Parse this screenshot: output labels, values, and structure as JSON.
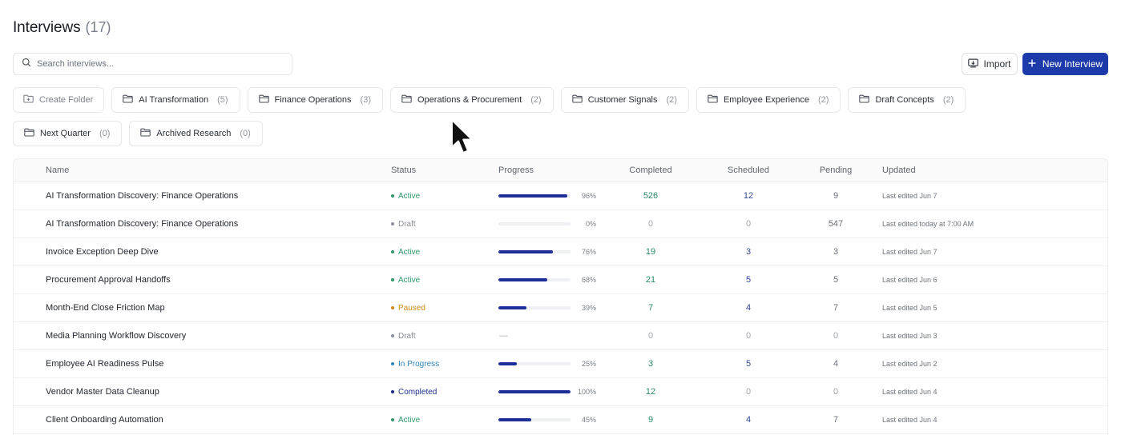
{
  "page": {
    "title": "Interviews",
    "count": "(17)"
  },
  "search": {
    "placeholder": "Search interviews...",
    "icon": "search-icon"
  },
  "actions": {
    "import_label": "Import",
    "import_icon": "import-icon",
    "new_label": "New Interview",
    "new_icon": "plus-icon"
  },
  "folders": {
    "create_label": "Create Folder",
    "items": [
      {
        "label": "AI Transformation",
        "count": "(5)"
      },
      {
        "label": "Finance Operations",
        "count": "(3)"
      },
      {
        "label": "Operations & Procurement",
        "count": "(2)"
      },
      {
        "label": "Customer Signals",
        "count": "(2)"
      },
      {
        "label": "Employee Experience",
        "count": "(2)"
      },
      {
        "label": "Draft Concepts",
        "count": "(2)"
      },
      {
        "label": "Next Quarter",
        "count": "(0)"
      },
      {
        "label": "Archived Research",
        "count": "(0)"
      }
    ]
  },
  "table": {
    "headers": {
      "name": "Name",
      "status": "Status",
      "progress": "Progress",
      "completed": "Completed",
      "scheduled": "Scheduled",
      "pending": "Pending",
      "updated": "Updated"
    },
    "rows": [
      {
        "name": "AI Transformation Discovery: Finance Operations",
        "status": "Active",
        "progress": 0.96,
        "progress_label": "96%",
        "completed": "526",
        "scheduled": "12",
        "pending": "9",
        "updated": "Last edited Jun 7"
      },
      {
        "name": "AI Transformation Discovery: Finance Operations",
        "status": "Draft",
        "progress": 0,
        "progress_label": "0%",
        "completed": "0",
        "scheduled": "0",
        "pending": "547",
        "updated": "Last edited today at 7:00 AM"
      },
      {
        "name": "Invoice Exception Deep Dive",
        "status": "Active",
        "progress": 0.76,
        "progress_label": "76%",
        "completed": "19",
        "scheduled": "3",
        "pending": "3",
        "updated": "Last edited Jun 7"
      },
      {
        "name": "Procurement Approval Handoffs",
        "status": "Active",
        "progress": 0.68,
        "progress_label": "68%",
        "completed": "21",
        "scheduled": "5",
        "pending": "5",
        "updated": "Last edited Jun 6"
      },
      {
        "name": "Month-End Close Friction Map",
        "status": "Paused",
        "progress": 0.39,
        "progress_label": "39%",
        "completed": "7",
        "scheduled": "4",
        "pending": "7",
        "updated": "Last edited Jun 5"
      },
      {
        "name": "Media Planning Workflow Discovery",
        "status": "Draft",
        "progress": null,
        "progress_label": "—",
        "completed": "0",
        "scheduled": "0",
        "pending": "0",
        "updated": "Last edited Jun 3"
      },
      {
        "name": "Employee AI Readiness Pulse",
        "status": "In Progress",
        "progress": 0.25,
        "progress_label": "25%",
        "completed": "3",
        "scheduled": "5",
        "pending": "4",
        "updated": "Last edited Jun 2"
      },
      {
        "name": "Vendor Master Data Cleanup",
        "status": "Completed",
        "progress": 1.0,
        "progress_label": "100%",
        "completed": "12",
        "scheduled": "0",
        "pending": "0",
        "updated": "Last edited Jun 4"
      },
      {
        "name": "Client Onboarding Automation",
        "status": "Active",
        "progress": 0.45,
        "progress_label": "45%",
        "completed": "9",
        "scheduled": "4",
        "pending": "7",
        "updated": "Last edited Jun 4"
      }
    ]
  },
  "colors": {
    "accent": "#1c3aa9",
    "progress_fill": "#1c2f99",
    "status": {
      "Active": "#2f9a6b",
      "Draft": "#8a8f99",
      "Paused": "#d28a1c",
      "In Progress": "#2e86c1",
      "Completed": "#1e2f8c"
    }
  }
}
